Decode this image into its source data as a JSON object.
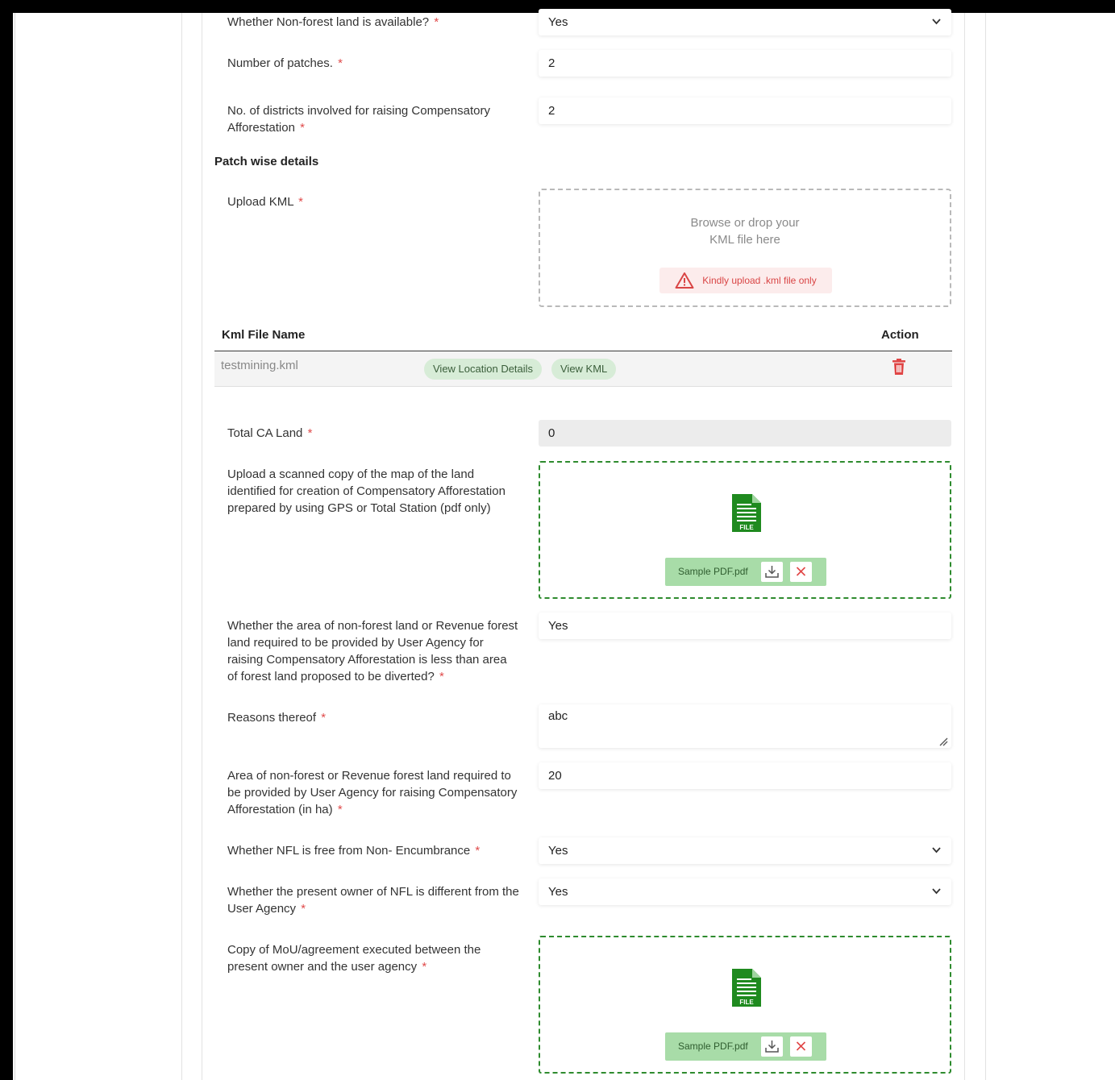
{
  "fields": {
    "nfl_available": {
      "label": "Whether Non-forest land is available?",
      "value": "Yes"
    },
    "num_patches": {
      "label": "Number of patches.",
      "value": "2"
    },
    "num_districts": {
      "label": "No. of districts involved for raising Compensatory Afforestation",
      "value": "2"
    },
    "upload_kml": {
      "label": "Upload KML"
    },
    "total_ca_land": {
      "label": "Total CA Land",
      "value": "0"
    },
    "scanned_map": {
      "label": "Upload a scanned copy of the map of the land identified for creation of Compensatory Afforestation prepared by using GPS or Total Station (pdf only)"
    },
    "area_less": {
      "label": "Whether the area of non-forest land or Revenue forest land required to be provided by User Agency for raising Compensatory Afforestation is less than area of forest land proposed to be diverted?",
      "value": "Yes"
    },
    "reasons": {
      "label": "Reasons thereof",
      "value": "abc"
    },
    "area_required": {
      "label": "Area of non-forest or Revenue forest land required to be provided by User Agency for raising Compensatory Afforestation (in ha)",
      "value": "20"
    },
    "nfl_free": {
      "label": "Whether NFL is free from Non- Encumbrance",
      "value": "Yes"
    },
    "owner_different": {
      "label": "Whether the present owner of NFL is different from the User Agency",
      "value": "Yes"
    },
    "mou_copy": {
      "label": "Copy of MoU/agreement executed between the present owner and the user agency"
    }
  },
  "required_mark": "*",
  "section": {
    "patch_wise": "Patch wise details"
  },
  "kml_drop": {
    "hint_line1": "Browse or drop your",
    "hint_line2": "KML file here",
    "warning": "Kindly upload .kml file only"
  },
  "kml_table": {
    "col_name": "Kml File Name",
    "col_action": "Action",
    "row": {
      "file": "testmining.kml",
      "view_location": "View Location Details",
      "view_kml": "View KML"
    }
  },
  "uploads": {
    "map_file": {
      "name": "Sample PDF.pdf",
      "icon_text": "FILE"
    },
    "mou_file": {
      "name": "Sample PDF.pdf",
      "icon_text": "FILE"
    }
  },
  "icons": {
    "select": "chevron-down-icon",
    "warning": "warning-triangle-icon",
    "delete": "trash-icon",
    "file": "file-icon",
    "download": "download-icon",
    "remove": "close-icon",
    "resize": "resize-grip-icon"
  },
  "colors": {
    "required": "#e04b4b",
    "warning_text": "#d94545",
    "pill_bg": "#d7ecd7",
    "file_green": "#1f8a1f",
    "chip_bg": "#a8dca8",
    "delete_red": "#e04545"
  }
}
